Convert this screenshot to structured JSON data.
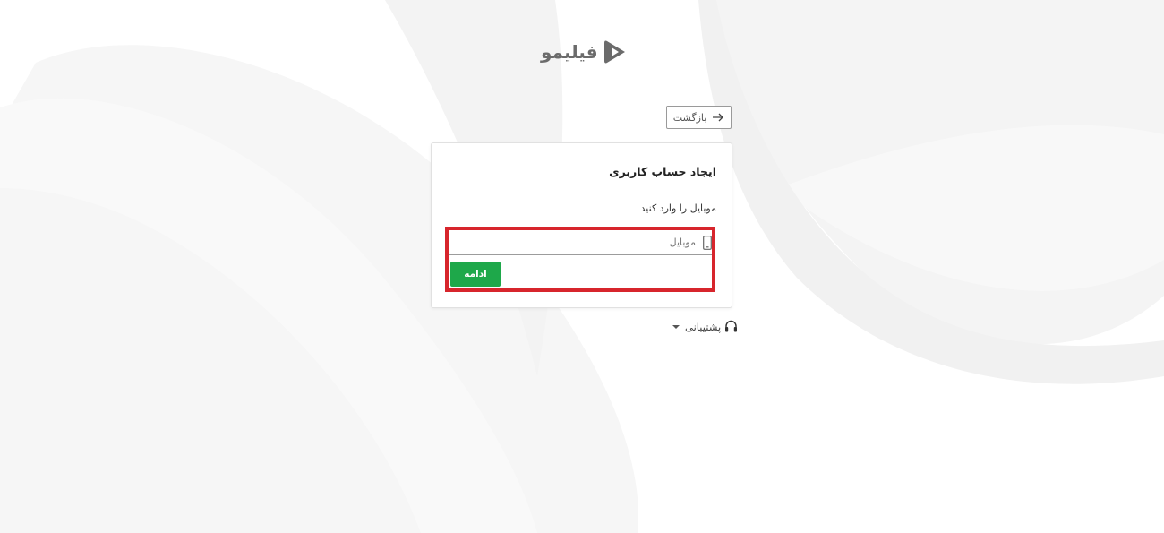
{
  "brand": {
    "name": "فیلیمو",
    "logo_icon": "play-triangle-icon",
    "color": "#6b6b6b"
  },
  "nav": {
    "back_label": "بازگشت",
    "back_icon": "arrow-right-icon"
  },
  "signup_card": {
    "title": "ایجاد حساب کاربری",
    "field_label": "موبایل را وارد کنید",
    "mobile_input": {
      "value": "",
      "placeholder": "موبایل",
      "icon": "mobile-phone-icon"
    },
    "continue_label": "ادامه",
    "continue_color": "#1ea84a"
  },
  "highlight": {
    "color": "#d7252c"
  },
  "support": {
    "label": "پشتیبانی",
    "icon": "headset-icon",
    "dropdown_icon": "caret-down-icon"
  }
}
